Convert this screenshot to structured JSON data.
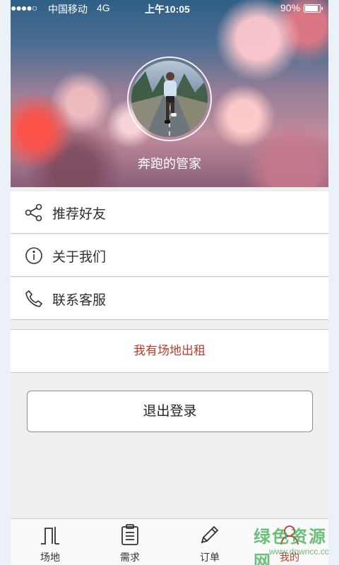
{
  "status_bar": {
    "signal_dots": "●●●●○",
    "carrier": "中国移动",
    "network": "4G",
    "time": "上午10:05",
    "battery": "90%"
  },
  "profile": {
    "username": "奔跑的管家"
  },
  "menu": {
    "items": [
      {
        "label": "推荐好友",
        "icon": "share-icon"
      },
      {
        "label": "关于我们",
        "icon": "info-icon"
      },
      {
        "label": "联系客服",
        "icon": "phone-icon"
      }
    ],
    "rent_label": "我有场地出租",
    "logout_label": "退出登录"
  },
  "tabbar": {
    "tabs": [
      {
        "label": "场地",
        "icon": "venue-icon"
      },
      {
        "label": "需求",
        "icon": "clipboard-icon"
      },
      {
        "label": "订单",
        "icon": "pencil-icon"
      },
      {
        "label": "我的",
        "icon": "user-icon",
        "active": true
      }
    ]
  },
  "watermark": {
    "title": "绿色资源网",
    "url": "www.downcc.com"
  },
  "colors": {
    "accent_red": "#c0392b",
    "watermark_green": "#3caa50"
  }
}
